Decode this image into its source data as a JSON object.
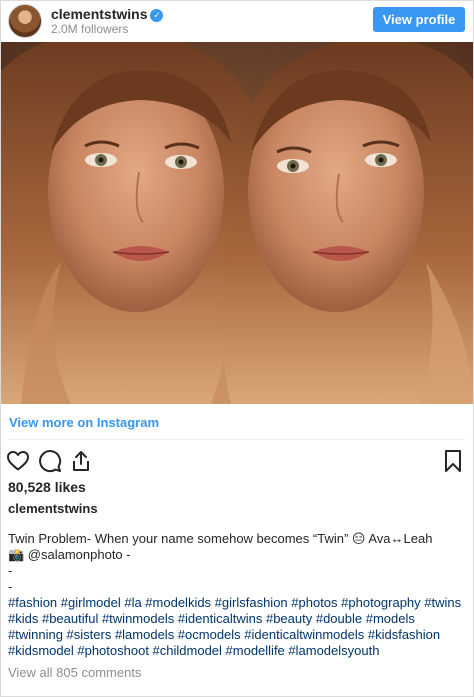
{
  "header": {
    "username": "clementstwins",
    "verified_icon": "verified-badge-icon",
    "followers": "2.0M followers",
    "view_profile_label": "View profile"
  },
  "post": {
    "view_more_label": "View more on Instagram",
    "icons": [
      "heart-icon",
      "comment-icon",
      "share-icon",
      "bookmark-icon"
    ],
    "likes": "80,528 likes",
    "caption_user": "clementstwins",
    "caption_line1": "Twin Problem- When your name somehow becomes “Twin” 😑 Ava↔Leah",
    "caption_line2": "📸 @salamonphoto -",
    "caption_line3": "-",
    "caption_line4": "-",
    "hashtags_line1": "#fashion #girlmodel #la #modelkids #girlsfashion #photos #photography #twins",
    "hashtags_line2": "#kids #beautiful #twinmodels #identicaltwins #beauty #double #models",
    "hashtags_line3": "#twinning #sisters #lamodels #ocmodels #identicaltwinmodels #kidsfashion",
    "hashtags_line4": "#kidsmodel #photoshoot #childmodel #modellife #lamodelsyouth",
    "view_comments": "View all 805 comments"
  },
  "colors": {
    "accent": "#3897f0",
    "hashtag": "#003569",
    "muted": "#8e8e8e"
  }
}
